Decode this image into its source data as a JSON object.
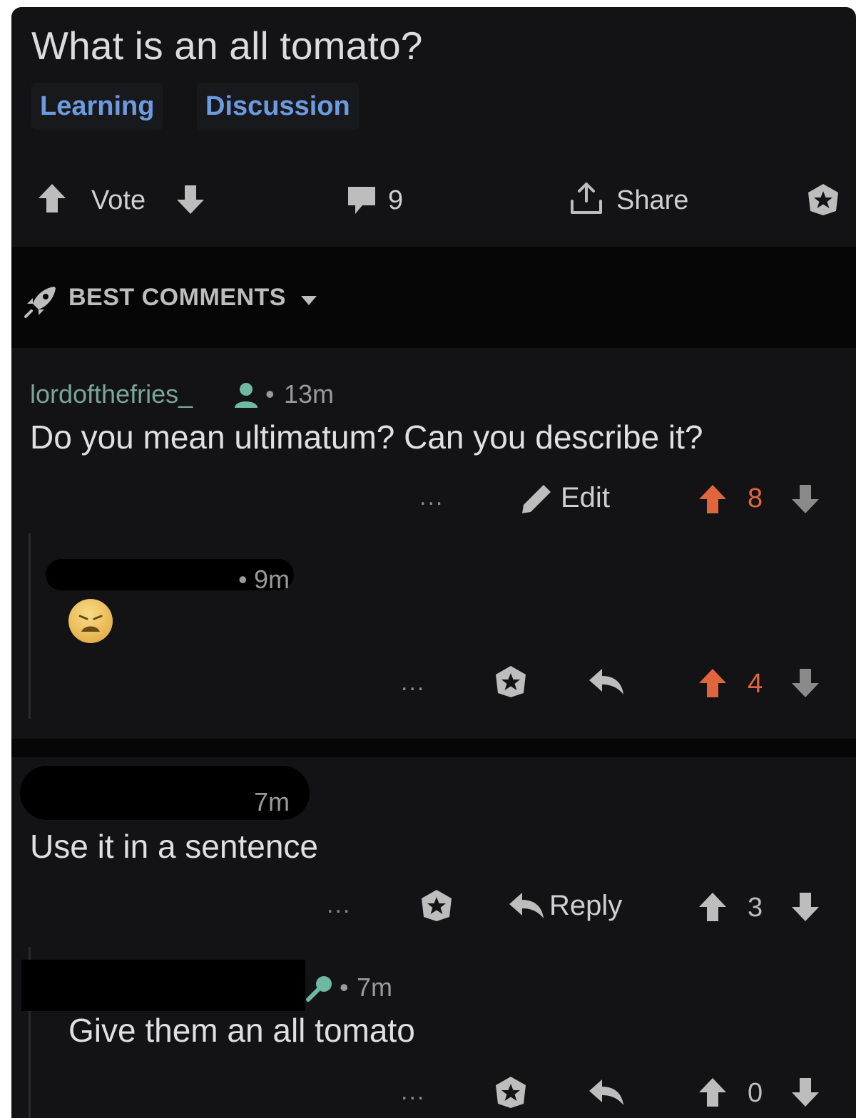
{
  "post": {
    "title": "What is an all tomato?",
    "tags": [
      "Learning",
      "Discussion"
    ],
    "vote_label": "Vote",
    "comment_count": "9",
    "share_label": "Share"
  },
  "sort": {
    "label": "BEST COMMENTS"
  },
  "comments": [
    {
      "username": "lordofthefries_",
      "time": "13m",
      "text": "Do you mean ultimatum? Can you describe it?",
      "more": "...",
      "edit_label": "Edit",
      "score": "8"
    },
    {
      "username": "[redacted]",
      "time": "9m",
      "text": "emoji",
      "more": "...",
      "score": "4"
    },
    {
      "username": "[redacted]",
      "time": "7m",
      "text": "Use it in a sentence",
      "more": "...",
      "reply_label": "Reply",
      "score": "3"
    },
    {
      "username": "[redacted]",
      "time": "7m",
      "text": "Give them an all tomato",
      "more": "...",
      "score": "0"
    }
  ],
  "colors": {
    "background": "#131316",
    "tag_text": "#6e9be0",
    "username": "#7aa59a",
    "upvoted": "#e0653c"
  }
}
